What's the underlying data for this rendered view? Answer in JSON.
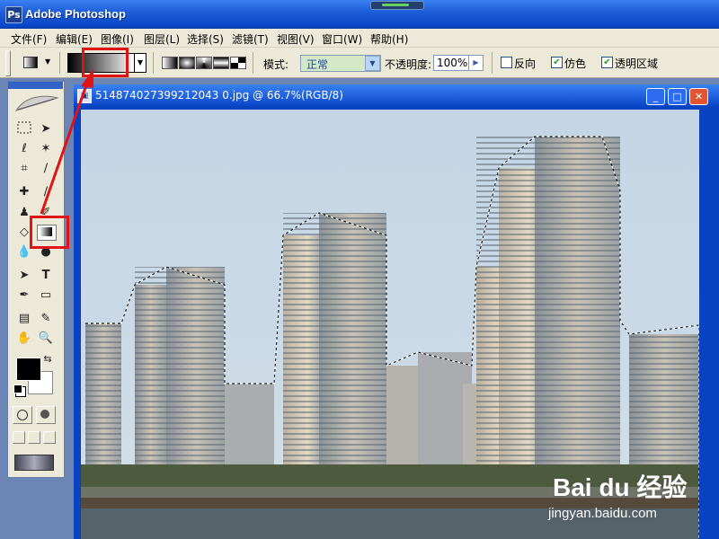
{
  "app": {
    "title": "Adobe Photoshop",
    "icon_letter": "Ps"
  },
  "menu": {
    "items": [
      "文件(F)",
      "编辑(E)",
      "图像(I)",
      "图层(L)",
      "选择(S)",
      "滤镜(T)",
      "视图(V)",
      "窗口(W)",
      "帮助(H)"
    ]
  },
  "options": {
    "mode_label": "模式:",
    "mode_value": "正常",
    "opacity_label": "不透明度:",
    "opacity_value": "100%",
    "reverse_label": "反向",
    "reverse_checked": false,
    "dither_label": "仿色",
    "dither_checked": true,
    "transparency_label": "透明区域",
    "transparency_checked": true
  },
  "document": {
    "title": "514874027399212043 0.jpg @ 66.7%(RGB/8)"
  },
  "watermark": {
    "brand": "Bai du 经验",
    "url": "jingyan.baidu.com"
  },
  "colors": {
    "foreground": "#000000",
    "background": "#ffffff",
    "annotation": "#e01414",
    "xp_blue": "#0a46c8"
  }
}
